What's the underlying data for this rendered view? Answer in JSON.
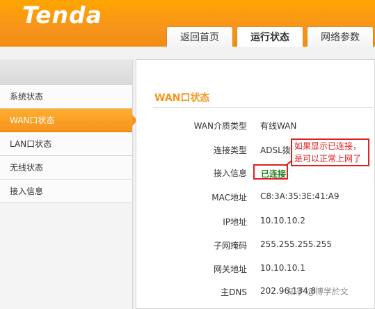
{
  "header": {
    "logo": "Tenda",
    "tabs": [
      {
        "label": "返回首页",
        "active": false
      },
      {
        "label": "运行状态",
        "active": true
      },
      {
        "label": "网络参数",
        "active": false
      }
    ],
    "accent_color": "#f7941d"
  },
  "sidebar": {
    "items": [
      {
        "label": "系统状态"
      },
      {
        "label": "WAN口状态",
        "active": true
      },
      {
        "label": "LAN口状态"
      },
      {
        "label": "无线状态"
      },
      {
        "label": "接入信息"
      }
    ]
  },
  "main": {
    "section_title": "WAN口状态",
    "rows": [
      {
        "label": "WAN介质类型",
        "value": "有线WAN"
      },
      {
        "label": "连接类型",
        "value": "ADSL拨号"
      },
      {
        "label": "接入信息",
        "value": "已连接"
      },
      {
        "label": "MAC地址",
        "value": "C8:3A:35:3E:41:A9"
      },
      {
        "label": "IP地址",
        "value": "10.10.10.2"
      },
      {
        "label": "子网掩码",
        "value": "255.255.255.255"
      },
      {
        "label": "网关地址",
        "value": "10.10.10.1"
      },
      {
        "label": "主DNS",
        "value": "202.96.134.8"
      }
    ],
    "callout": {
      "line1": "如果显示已连接，",
      "line2": "是可以正常上网了"
    }
  },
  "watermark": "知乎 @博学於文"
}
